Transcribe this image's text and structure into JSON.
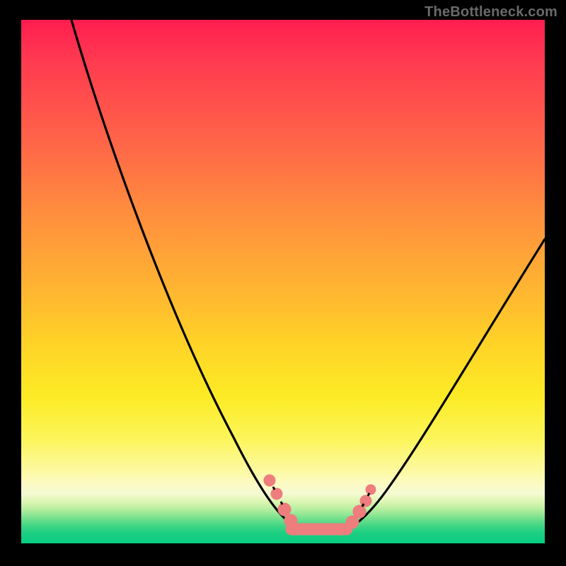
{
  "watermark": "TheBottleneck.com",
  "chart_data": {
    "type": "line",
    "title": "",
    "xlabel": "",
    "ylabel": "",
    "xlim": [
      0,
      100
    ],
    "ylim": [
      0,
      100
    ],
    "x": [
      0,
      5,
      10,
      15,
      20,
      25,
      30,
      35,
      40,
      45,
      48,
      50,
      52,
      54,
      56,
      58,
      60,
      65,
      70,
      75,
      80,
      85,
      90,
      95,
      100
    ],
    "values": [
      120,
      102,
      86,
      72,
      60,
      49,
      39,
      30,
      22,
      14,
      8,
      4,
      2,
      1,
      1,
      2,
      4,
      9,
      16,
      24,
      33,
      42,
      52,
      62,
      72
    ],
    "annotations": [
      {
        "type": "marker-cluster",
        "style": "pink-dots",
        "x_range": [
          42,
          60
        ],
        "y_range": [
          0,
          12
        ]
      }
    ],
    "colors": {
      "curve": "#000000",
      "markers": "#ee7d7d",
      "gradient_top": "#ff1d4f",
      "gradient_bottom": "#07cd82"
    }
  }
}
